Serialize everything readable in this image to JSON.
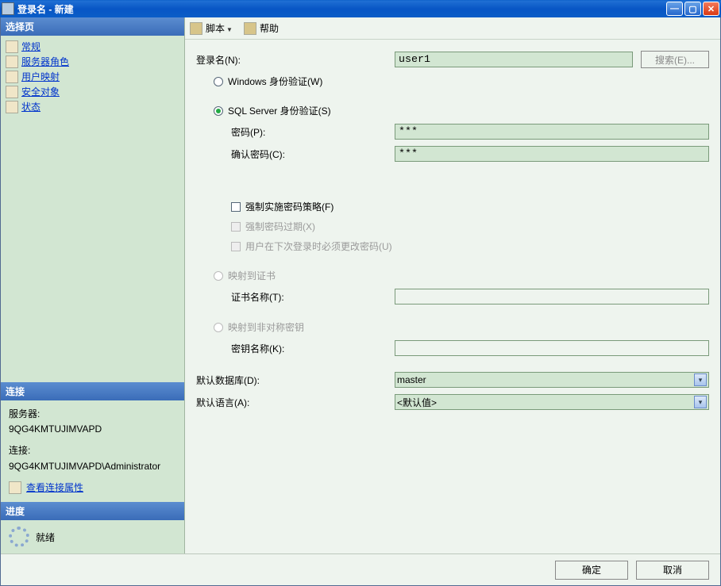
{
  "window": {
    "title": "登录名 - 新建"
  },
  "sidebar": {
    "pages_header": "选择页",
    "items": [
      {
        "label": "常规"
      },
      {
        "label": "服务器角色"
      },
      {
        "label": "用户映射"
      },
      {
        "label": "安全对象"
      },
      {
        "label": "状态"
      }
    ],
    "connection_header": "连接",
    "server_label": "服务器:",
    "server_value": "9QG4KMTUJIMVAPD",
    "connection_label": "连接:",
    "connection_value": "9QG4KMTUJIMVAPD\\Administrator",
    "view_conn_props": "查看连接属性",
    "progress_header": "进度",
    "progress_status": "就绪"
  },
  "toolbar": {
    "script_label": "脚本",
    "help_label": "帮助"
  },
  "form": {
    "login_name_label": "登录名(N):",
    "login_name_value": "user1",
    "search_btn": "搜索(E)...",
    "auth_windows": "Windows 身份验证(W)",
    "auth_sql": "SQL Server 身份验证(S)",
    "password_label": "密码(P):",
    "password_value": "***",
    "confirm_password_label": "确认密码(C):",
    "confirm_password_value": "***",
    "enforce_policy": "强制实施密码策略(F)",
    "enforce_expire": "强制密码过期(X)",
    "must_change": "用户在下次登录时必须更改密码(U)",
    "map_cert": "映射到证书",
    "cert_name_label": "证书名称(T):",
    "map_asym": "映射到非对称密钥",
    "key_name_label": "密钥名称(K):",
    "default_db_label": "默认数据库(D):",
    "default_db_value": "master",
    "default_lang_label": "默认语言(A):",
    "default_lang_value": "<默认值>"
  },
  "footer": {
    "ok": "确定",
    "cancel": "取消"
  }
}
